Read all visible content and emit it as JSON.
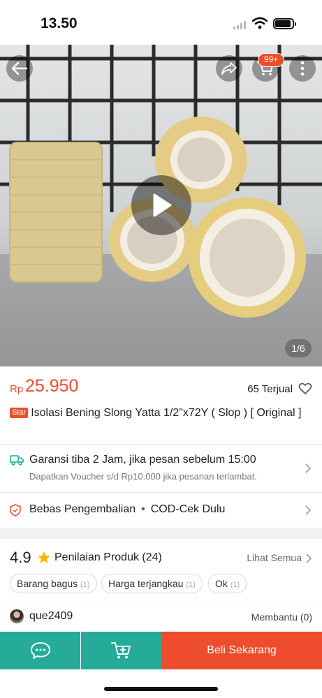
{
  "status_bar": {
    "time": "13.50"
  },
  "product_image": {
    "cart_badge": "99+",
    "counter": "1/6"
  },
  "product": {
    "currency": "Rp",
    "price": "25.950",
    "sold": "65 Terjual",
    "badge": "Star",
    "title": "Isolasi Bening Slong Yatta 1/2\"x72Y ( Slop ) [ Original ]"
  },
  "shipping": {
    "title": "Garansi tiba 2 Jam, jika pesan sebelum 15:00",
    "subtitle": "Dapatkan Voucher s/d Rp10.000 jika pesanan terlambat."
  },
  "returns": {
    "free_return": "Bebas Pengembalian",
    "separator": "•",
    "cod": "COD-Cek Dulu"
  },
  "ratings": {
    "score": "4.9",
    "label": "Penilaian Produk",
    "count": "(24)",
    "see_all": "Lihat Semua",
    "chips": [
      {
        "label": "Barang bagus",
        "count": "(1)"
      },
      {
        "label": "Harga terjangkau",
        "count": "(1)"
      },
      {
        "label": "Ok",
        "count": "(1)"
      }
    ]
  },
  "review": {
    "username": "que2409",
    "helpful": "Membantu (0)"
  },
  "bottom_bar": {
    "buy_label": "Beli Sekarang"
  },
  "colors": {
    "brand": "#ee4d2d",
    "teal": "#26aa99"
  }
}
